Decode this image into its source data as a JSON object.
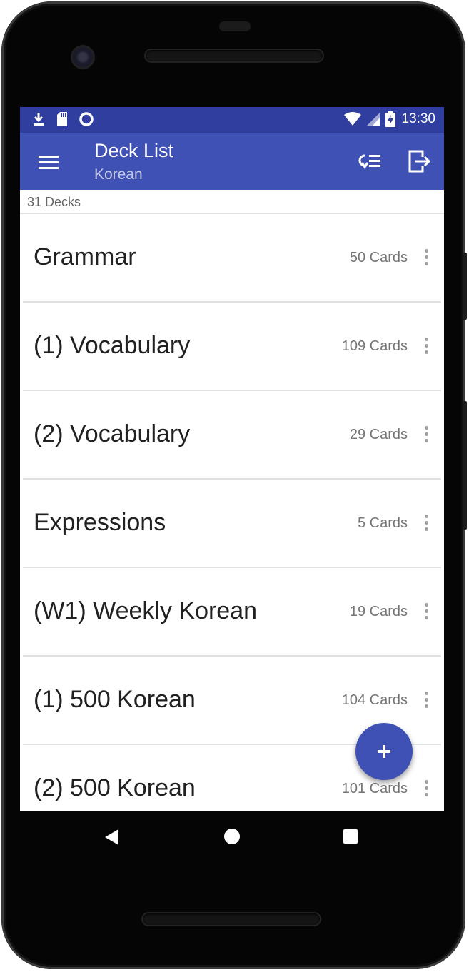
{
  "statusbar": {
    "time": "13:30",
    "icons_left": [
      "download-icon",
      "sd-card-icon",
      "sync-circle-icon"
    ],
    "icons_right": [
      "wifi-icon",
      "cell-signal-icon",
      "battery-charging-icon"
    ]
  },
  "appbar": {
    "title": "Deck List",
    "subtitle": "Korean",
    "menu_icon": "hamburger-menu-icon",
    "actions": [
      "sort-icon",
      "exit-icon"
    ]
  },
  "deck_count": "31 Decks",
  "decks": [
    {
      "name": "Grammar",
      "count": "50 Cards"
    },
    {
      "name": "(1) Vocabulary",
      "count": "109 Cards"
    },
    {
      "name": "(2) Vocabulary",
      "count": "29 Cards"
    },
    {
      "name": "Expressions",
      "count": "5 Cards"
    },
    {
      "name": "(W1) Weekly Korean",
      "count": "19 Cards"
    },
    {
      "name": "(1) 500 Korean",
      "count": "104 Cards"
    },
    {
      "name": "(2) 500 Korean",
      "count": "101 Cards"
    }
  ],
  "fab": {
    "icon": "plus-icon"
  },
  "colors": {
    "primary": "#3f51b5",
    "primary_dark": "#303f9f",
    "accent": "#3f51b5"
  },
  "navbar": [
    "back-icon",
    "home-icon",
    "recents-icon"
  ]
}
